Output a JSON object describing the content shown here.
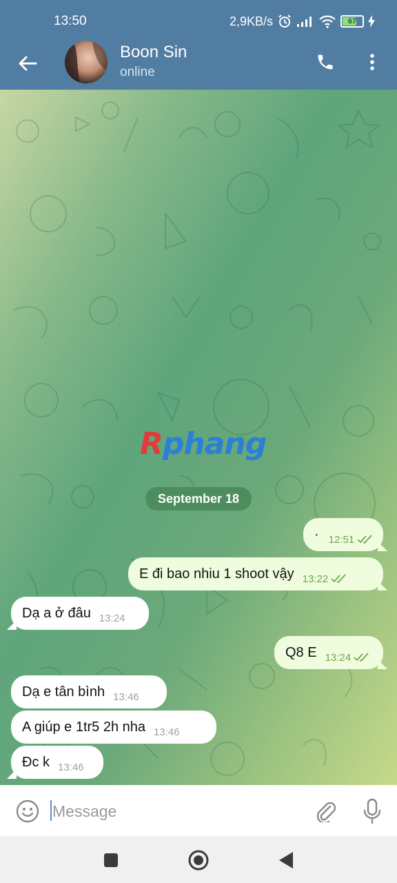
{
  "status_bar": {
    "time": "13:50",
    "net_speed": "2,9KB/s",
    "battery": "67",
    "icons": [
      "alarm-icon",
      "signal-icon",
      "wifi-icon",
      "battery-icon",
      "charging-icon"
    ]
  },
  "header": {
    "name": "Boon Sin",
    "status": "online",
    "color": "#517da2"
  },
  "watermark": {
    "first": "R",
    "rest": "phang"
  },
  "chat": {
    "date": "September 18",
    "messages": [
      {
        "dir": "out",
        "text": "·",
        "time": "12:51",
        "read": true
      },
      {
        "dir": "out",
        "text": "E đi bao nhiu 1 shoot vậy",
        "time": "13:22",
        "read": true
      },
      {
        "dir": "in",
        "text": "Dạ a ở đâu",
        "time": "13:24"
      },
      {
        "dir": "out",
        "text": "Q8 E",
        "time": "13:24",
        "read": true
      },
      {
        "dir": "in",
        "text": "Dạ e tân bình",
        "time": "13:46"
      },
      {
        "dir": "in",
        "text": "A giúp e 1tr5 2h nha",
        "time": "13:46"
      },
      {
        "dir": "in",
        "text": "Đc k",
        "time": "13:46"
      }
    ],
    "out_bubble_color": "#effdde",
    "in_bubble_color": "#ffffff"
  },
  "input": {
    "placeholder": "Message",
    "value": ""
  },
  "nav": {
    "icons": [
      "recents-square-icon",
      "home-circle-icon",
      "back-triangle-icon"
    ]
  }
}
